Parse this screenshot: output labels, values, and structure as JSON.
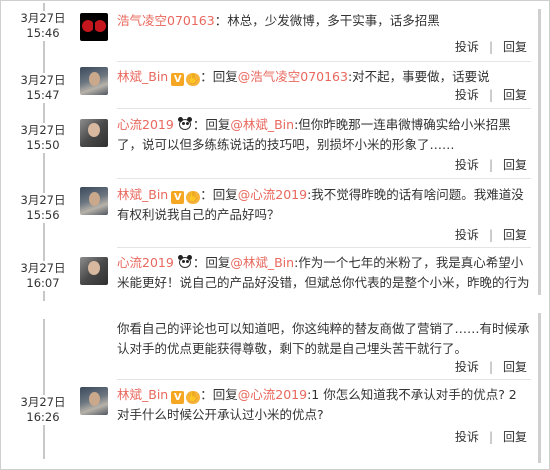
{
  "actions": {
    "report": "投诉",
    "reply": "回复"
  },
  "entries": [
    {
      "date": "3月27日",
      "time": "15:46",
      "user": "浩气凌空070163",
      "sep": "：",
      "text": "林总，少发微博，多干实事，话多招黑"
    },
    {
      "date": "3月27日",
      "time": "15:47",
      "user": "林斌_Bin",
      "reply_word": "：回复",
      "mention": "@浩气凌空070163",
      "text": ":对不起，事要做，话要说"
    },
    {
      "date": "3月27日",
      "time": "15:50",
      "user": "心流2019",
      "reply_word": "：回复",
      "mention": "@林斌_Bin",
      "text": ":但你昨晚那一连串微博确实给小米招黑了，说可以但多练练说话的技巧吧，别损坏小米的形象了……"
    },
    {
      "date": "3月27日",
      "time": "15:56",
      "user": "林斌_Bin",
      "reply_word": "：回复",
      "mention": "@心流2019",
      "text": ":我不觉得昨晚的话有啥问题。我难道没有权利说我自己的产品好吗？"
    },
    {
      "date": "3月27日",
      "time": "16:07",
      "user": "心流2019",
      "reply_word": "：回复",
      "mention": "@林斌_Bin",
      "text": ":作为一个七年的米粉了，我是真心希望小米能更好！说自己的产品好没错，但斌总你代表的是整个小米，昨晚的行为起到什么效果"
    },
    {
      "text": "你看自己的评论也可以知道吧，你这纯粹的替友商做了营销了……有时候承认对手的优点更能获得尊敬，剩下的就是自己埋头苦干就行了。"
    },
    {
      "date": "3月27日",
      "time": "16:26",
      "user": "林斌_Bin",
      "reply_word": "：回复",
      "mention": "@心流2019",
      "text": ":1 你怎么知道我不承认对手的优点? 2 对手什么时候公开承认过小米的优点?"
    }
  ]
}
